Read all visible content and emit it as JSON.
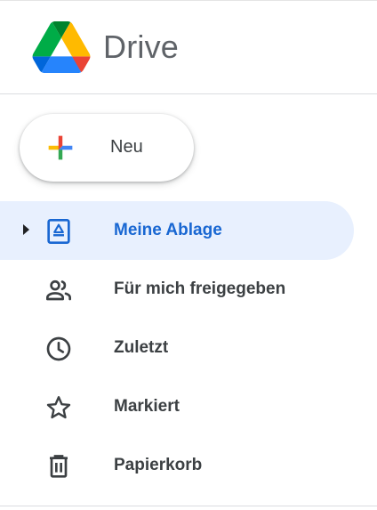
{
  "app": {
    "title": "Drive"
  },
  "new_button": {
    "label": "Neu"
  },
  "nav": {
    "items": [
      {
        "label": "Meine Ablage",
        "icon": "my-drive-icon",
        "active": true
      },
      {
        "label": "Für mich freigegeben",
        "icon": "shared-with-me-icon",
        "active": false
      },
      {
        "label": "Zuletzt",
        "icon": "clock-icon",
        "active": false
      },
      {
        "label": "Markiert",
        "icon": "star-icon",
        "active": false
      },
      {
        "label": "Papierkorb",
        "icon": "trash-icon",
        "active": false
      }
    ]
  },
  "colors": {
    "active_bg": "#e8f0fe",
    "active_text": "#1967d2",
    "text": "#3c4043",
    "icon": "#5f6368"
  }
}
